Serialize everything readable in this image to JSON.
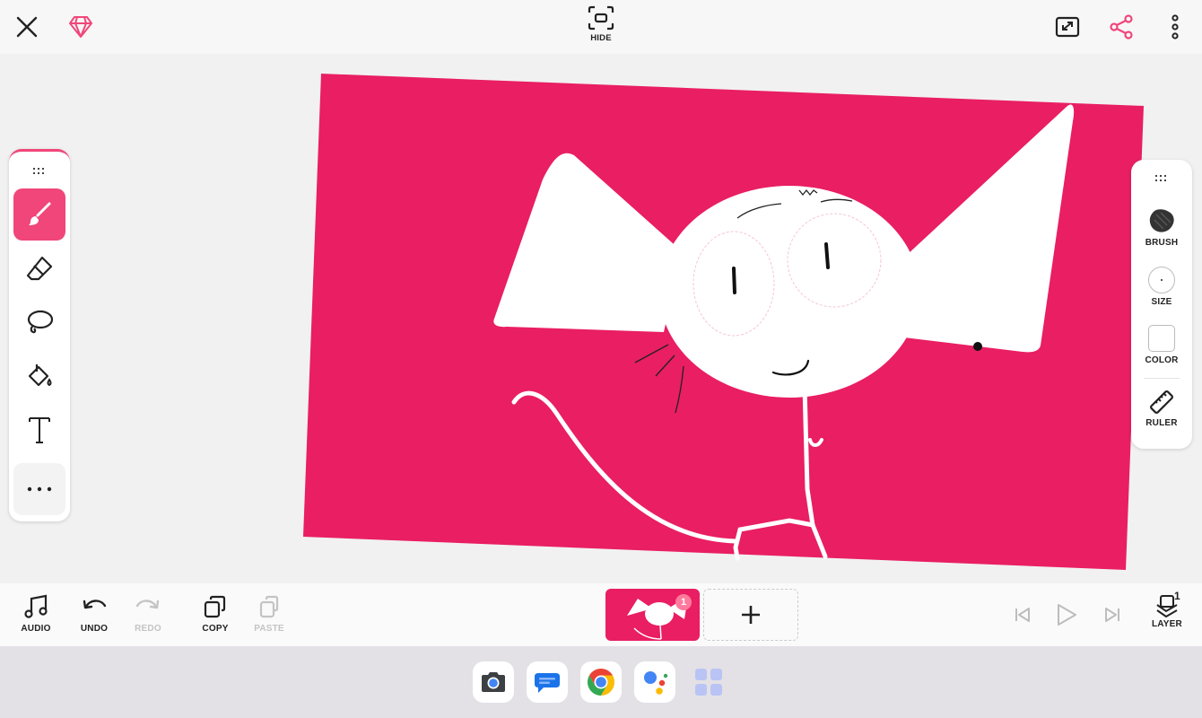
{
  "topbar": {
    "hide_label": "HIDE"
  },
  "left_toolbar": {
    "tools": [
      {
        "name": "brush",
        "icon": "paintbrush-icon",
        "active": true
      },
      {
        "name": "eraser",
        "icon": "eraser-icon"
      },
      {
        "name": "lasso",
        "icon": "lasso-icon"
      },
      {
        "name": "fill",
        "icon": "paint-bucket-icon"
      },
      {
        "name": "text",
        "icon": "text-icon"
      },
      {
        "name": "more",
        "icon": "more-horizontal-icon"
      }
    ]
  },
  "right_toolbar": {
    "brush_label": "BRUSH",
    "size_label": "SIZE",
    "color_label": "COLOR",
    "ruler_label": "RULER"
  },
  "bottombar": {
    "audio_label": "AUDIO",
    "undo_label": "UNDO",
    "redo_label": "REDO",
    "copy_label": "COPY",
    "paste_label": "PASTE",
    "layer_label": "LAYER",
    "layer_count": "1",
    "frame_badge": "1"
  },
  "dock": {
    "apps": [
      "camera-icon",
      "messages-icon",
      "chrome-icon",
      "assistant-icon",
      "app-drawer-icon"
    ]
  },
  "colors": {
    "accent": "#f0467a",
    "canvas_bg": "#e91e63",
    "drawing": "#ffffff"
  }
}
